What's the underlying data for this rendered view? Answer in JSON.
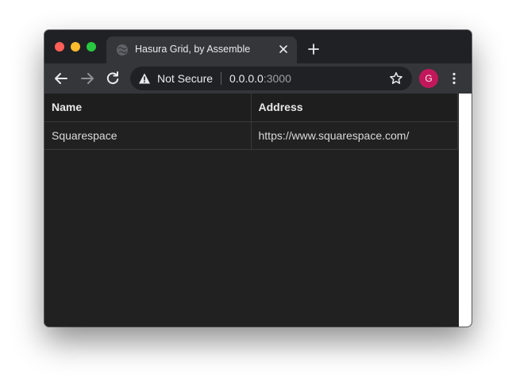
{
  "browser": {
    "tab_title": "Hasura Grid, by Assemble",
    "security_label": "Not Secure",
    "url_host": "0.0.0.0",
    "url_port": ":3000",
    "profile_initial": "G"
  },
  "grid": {
    "columns": [
      "Name",
      "Address"
    ],
    "rows": [
      [
        "Squarespace",
        "https://www.squarespace.com/"
      ]
    ]
  },
  "colors": {
    "window_bg": "#202124",
    "toolbar_bg": "#35363a",
    "content_bg": "#212121",
    "avatar": "#c2185b"
  },
  "icons": [
    "favicon-globe-icon",
    "close-icon",
    "plus-icon",
    "back-arrow-icon",
    "forward-arrow-icon",
    "reload-icon",
    "warning-icon",
    "star-icon",
    "kebab-menu-icon"
  ]
}
